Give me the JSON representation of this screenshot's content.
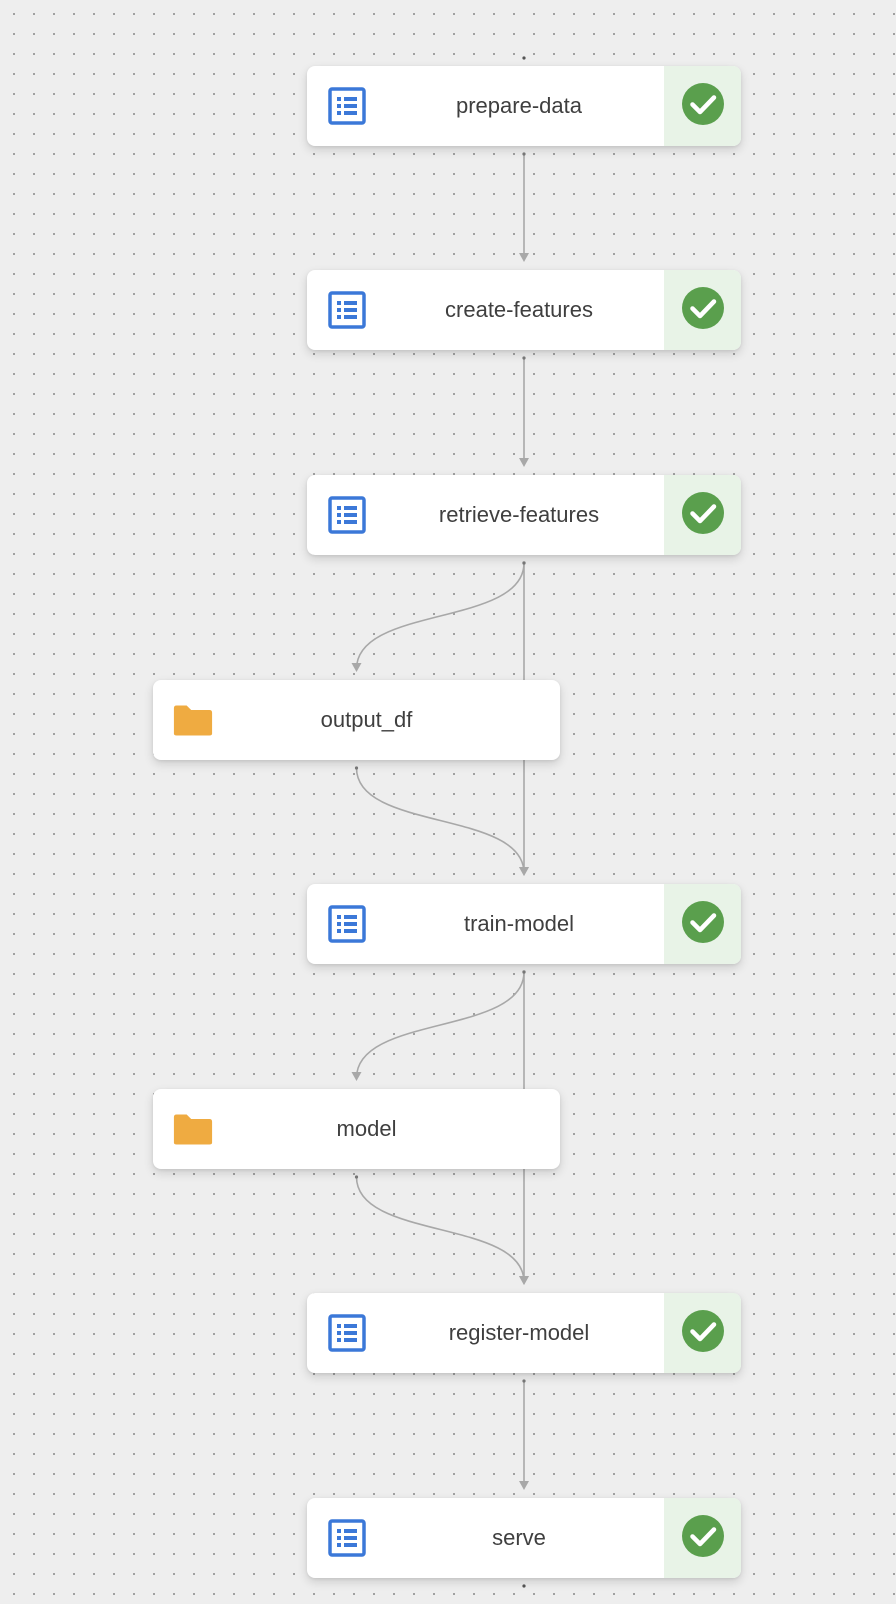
{
  "colors": {
    "background": "#eeeeee",
    "dot": "#9a9a9a",
    "edge": "#a8a8a8",
    "step_icon": "#3b78d8",
    "artifact_icon": "#efab41",
    "success": "#5a9f4d",
    "success_cell": "#e8f3e7"
  },
  "nodes": [
    {
      "id": "prepare-data",
      "label": "prepare-data",
      "kind": "step",
      "icon": "list-document-icon",
      "status": "success",
      "status_icon": "check-circle-icon"
    },
    {
      "id": "create-features",
      "label": "create-features",
      "kind": "step",
      "icon": "list-document-icon",
      "status": "success",
      "status_icon": "check-circle-icon"
    },
    {
      "id": "retrieve-features",
      "label": "retrieve-features",
      "kind": "step",
      "icon": "list-document-icon",
      "status": "success",
      "status_icon": "check-circle-icon"
    },
    {
      "id": "output_df",
      "label": "output_df",
      "kind": "artifact",
      "icon": "folder-icon"
    },
    {
      "id": "train-model",
      "label": "train-model",
      "kind": "step",
      "icon": "list-document-icon",
      "status": "success",
      "status_icon": "check-circle-icon"
    },
    {
      "id": "model",
      "label": "model",
      "kind": "artifact",
      "icon": "folder-icon"
    },
    {
      "id": "register-model",
      "label": "register-model",
      "kind": "step",
      "icon": "list-document-icon",
      "status": "success",
      "status_icon": "check-circle-icon"
    },
    {
      "id": "serve",
      "label": "serve",
      "kind": "step",
      "icon": "list-document-icon",
      "status": "success",
      "status_icon": "check-circle-icon"
    }
  ],
  "edges": [
    {
      "from": "prepare-data",
      "to": "create-features"
    },
    {
      "from": "create-features",
      "to": "retrieve-features"
    },
    {
      "from": "retrieve-features",
      "to": "output_df"
    },
    {
      "from": "retrieve-features",
      "to": "train-model"
    },
    {
      "from": "output_df",
      "to": "train-model"
    },
    {
      "from": "train-model",
      "to": "model"
    },
    {
      "from": "train-model",
      "to": "register-model"
    },
    {
      "from": "model",
      "to": "register-model"
    },
    {
      "from": "register-model",
      "to": "serve"
    }
  ]
}
